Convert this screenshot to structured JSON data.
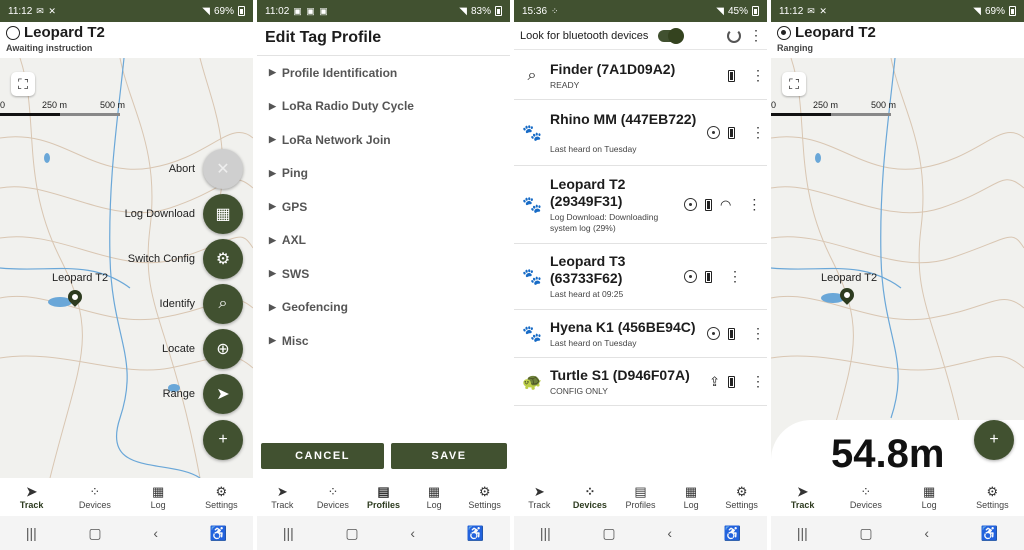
{
  "screens": {
    "track": {
      "status_time": "11:12",
      "status_battery": "69%",
      "title": "Leopard T2",
      "subtitle": "Awaiting instruction",
      "scale": {
        "t0": "0",
        "t1": "250 m",
        "t2": "500 m"
      },
      "pin_label": "Leopard T2",
      "fab_menu": [
        {
          "label": "Abort",
          "icon": "close-icon"
        },
        {
          "label": "Log Download",
          "icon": "calendar-icon"
        },
        {
          "label": "Switch Config",
          "icon": "gear-icon"
        },
        {
          "label": "Identify",
          "icon": "search-icon"
        },
        {
          "label": "Locate",
          "icon": "locate-icon"
        },
        {
          "label": "Range",
          "icon": "navigation-icon"
        }
      ]
    },
    "edit_profile": {
      "status_time": "11:02",
      "status_battery": "83%",
      "title": "Edit Tag Profile",
      "sections": [
        "Profile Identification",
        "LoRa Radio Duty Cycle",
        "LoRa Network Join",
        "Ping",
        "GPS",
        "AXL",
        "SWS",
        "Geofencing",
        "Misc"
      ],
      "cancel": "CANCEL",
      "save": "SAVE"
    },
    "devices": {
      "status_time": "15:36",
      "status_battery": "45%",
      "toggle_label": "Look for bluetooth devices",
      "list": [
        {
          "name": "Finder (7A1D09A2)",
          "status": "READY",
          "icon": "search-icon"
        },
        {
          "name": "Rhino MM (447EB722)",
          "status": "Last heard on Tuesday",
          "icon": "paw-icon"
        },
        {
          "name": "Leopard T2 (29349F31)",
          "status": "Log Download: Downloading system log (29%)",
          "icon": "paw-icon"
        },
        {
          "name": "Leopard T3 (63733F62)",
          "status": "Last heard at 09:25",
          "icon": "paw-icon"
        },
        {
          "name": "Hyena K1 (456BE94C)",
          "status": "Last heard on Tuesday",
          "icon": "paw-icon"
        },
        {
          "name": "Turtle S1 (D946F07A)",
          "status": "CONFIG ONLY",
          "icon": "turtle-icon"
        }
      ]
    },
    "ranging": {
      "status_time": "11:12",
      "status_battery": "69%",
      "title": "Leopard T2",
      "subtitle": "Ranging",
      "scale": {
        "t0": "0",
        "t1": "250 m",
        "t2": "500 m"
      },
      "pin_label": "Leopard T2",
      "range_value": "54.8m"
    }
  },
  "nav": {
    "three": [
      "Track",
      "Devices",
      "Log",
      "Settings"
    ],
    "five": [
      "Track",
      "Devices",
      "Profiles",
      "Log",
      "Settings"
    ]
  },
  "colors": {
    "accent": "#415130",
    "map_bg": "#f1f1ee",
    "water": "#6aa7d8"
  }
}
